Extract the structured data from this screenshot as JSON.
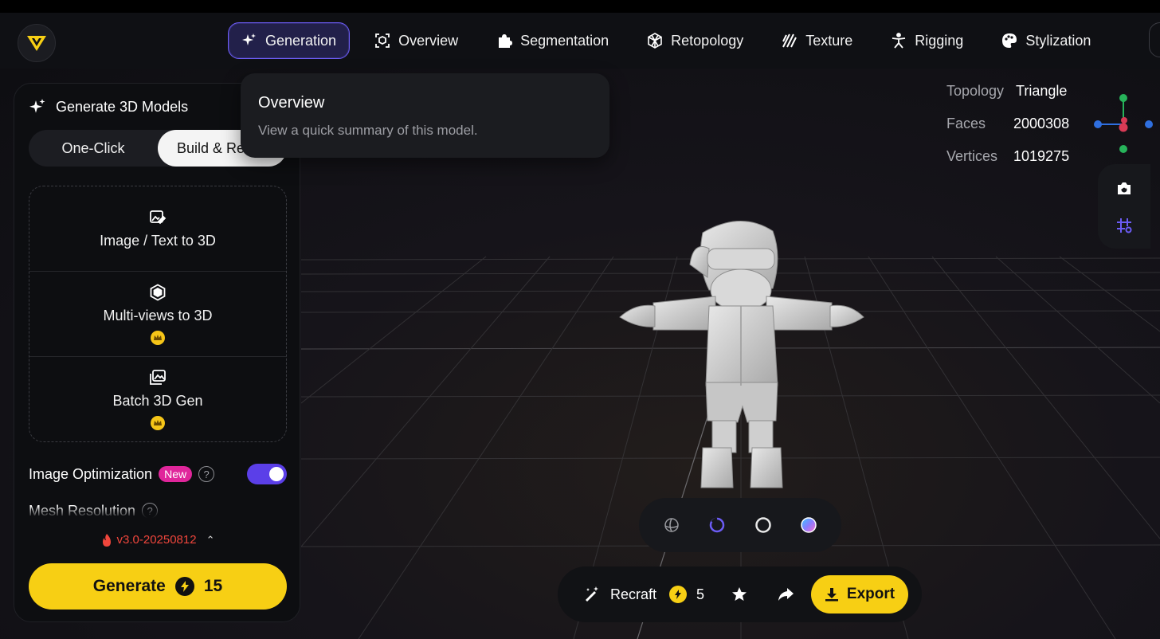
{
  "nav": {
    "items": [
      {
        "label": "Generation",
        "icon": "sparkle-icon",
        "active": true
      },
      {
        "label": "Overview",
        "icon": "cube-frame-icon"
      },
      {
        "label": "Segmentation",
        "icon": "puzzle-icon"
      },
      {
        "label": "Retopology",
        "icon": "mesh-cube-icon"
      },
      {
        "label": "Texture",
        "icon": "stripes-icon"
      },
      {
        "label": "Rigging",
        "icon": "figure-icon"
      },
      {
        "label": "Stylization",
        "icon": "palette-icon"
      }
    ]
  },
  "tooltip": {
    "title": "Overview",
    "description": "View a quick summary of this model."
  },
  "panel": {
    "title": "Generate 3D Models",
    "modes": [
      "One-Click",
      "Build & Refine"
    ],
    "selected_mode": "Build & Refine",
    "options": [
      {
        "label": "Image / Text to 3D",
        "icon": "image-edit-icon",
        "premium": false
      },
      {
        "label": "Multi-views to 3D",
        "icon": "cube-icon",
        "premium": true
      },
      {
        "label": "Batch 3D Gen",
        "icon": "images-icon",
        "premium": true
      }
    ],
    "image_optimization": {
      "label": "Image Optimization",
      "badge": "New",
      "enabled": true
    },
    "mesh_resolution_label": "Mesh Resolution",
    "help_glyph": "?",
    "version": "v3.0-20250812",
    "generate": {
      "label": "Generate",
      "cost": "15"
    }
  },
  "stats": {
    "topology_label": "Topology",
    "topology_value": "Triangle",
    "faces_label": "Faces",
    "faces_value": "2000308",
    "vertices_label": "Vertices",
    "vertices_value": "1019275"
  },
  "action_bar": {
    "recraft_label": "Recraft",
    "recraft_cost": "5",
    "export_label": "Export"
  },
  "colors": {
    "accent": "#6c5cf5",
    "brand_yellow": "#f7cf14",
    "new_badge": "#e0269b",
    "version_red": "#f0463c"
  }
}
